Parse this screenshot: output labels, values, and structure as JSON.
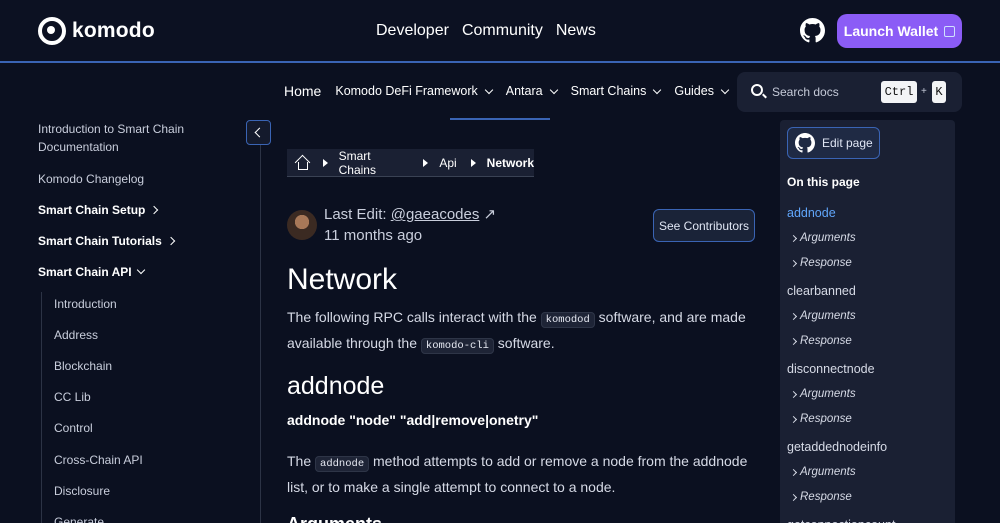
{
  "brand": {
    "name": "komodo"
  },
  "topnav": [
    "Developer",
    "Community",
    "News"
  ],
  "launch_wallet": "Launch Wallet",
  "subnav": {
    "home": "Home",
    "items": [
      "Komodo DeFi Framework",
      "Antara",
      "Smart Chains",
      "Guides"
    ]
  },
  "search": {
    "placeholder": "Search docs",
    "key1": "Ctrl",
    "plus": "+",
    "key2": "K"
  },
  "sidebar": {
    "items": [
      "Introduction to Smart Chain Documentation",
      "Komodo Changelog",
      "Smart Chain Setup",
      "Smart Chain Tutorials",
      "Smart Chain API"
    ],
    "sub_items": [
      "Introduction",
      "Address",
      "Blockchain",
      "CC Lib",
      "Control",
      "Cross-Chain API",
      "Disclosure",
      "Generate"
    ]
  },
  "breadcrumb": [
    "Smart Chains",
    "Api",
    "Network"
  ],
  "meta": {
    "last_edit_label": "Last Edit:",
    "author": "@gaeacodes",
    "ago": "11 months ago",
    "contributors_button": "See Contributors"
  },
  "content": {
    "title": "Network",
    "intro_1": "The following RPC calls interact with the",
    "intro_code_1": "komodod",
    "intro_2": "software, and are made available through the",
    "intro_code_2": "komodo-cli",
    "intro_3": "software.",
    "section_title": "addnode",
    "signature": "addnode \"node\" \"add|remove|onetry\"",
    "desc_1": "The",
    "desc_code": "addnode",
    "desc_2": "method attempts to add or remove a node from the addnode list, or to make a single attempt to connect to a node.",
    "next_heading": "Arguments"
  },
  "toc": {
    "edit_page": "Edit page",
    "title": "On this page",
    "entries": [
      {
        "label": "addnode",
        "active": true,
        "subs": [
          "Arguments",
          "Response"
        ]
      },
      {
        "label": "clearbanned",
        "active": false,
        "subs": [
          "Arguments",
          "Response"
        ]
      },
      {
        "label": "disconnectnode",
        "active": false,
        "subs": [
          "Arguments",
          "Response"
        ]
      },
      {
        "label": "getaddednodeinfo",
        "active": false,
        "subs": [
          "Arguments",
          "Response"
        ]
      },
      {
        "label": "getconnectioncount",
        "active": false,
        "subs": []
      }
    ]
  },
  "colors": {
    "background": "#0b1020",
    "accent": "#8b5cf6",
    "link": "#60a5fa",
    "border": "#3a64b4"
  }
}
